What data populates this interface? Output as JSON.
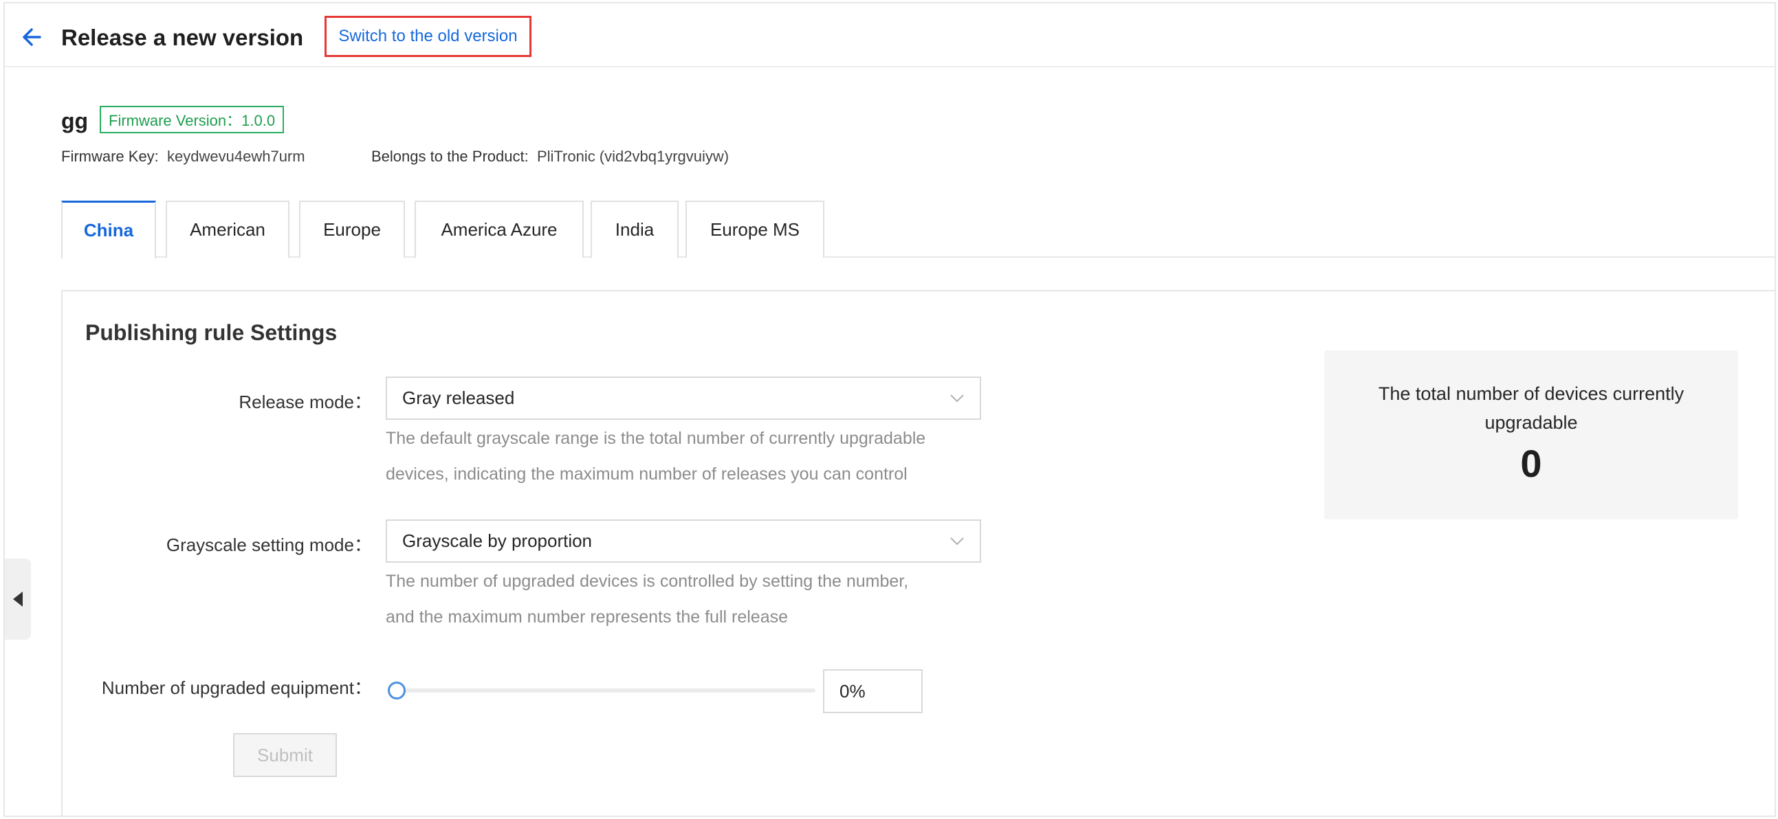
{
  "header": {
    "title": "Release a new version",
    "switch_label": "Switch to the old version"
  },
  "firmware": {
    "name": "gg",
    "version_badge": "Firmware Version：1.0.0",
    "key_label": "Firmware Key:",
    "key_value": "keydwevu4ewh7urm",
    "product_label": "Belongs to the Product:",
    "product_value": "PliTronic (vid2vbq1yrgvuiyw)"
  },
  "tabs": [
    {
      "label": "China",
      "active": true
    },
    {
      "label": "American"
    },
    {
      "label": "Europe"
    },
    {
      "label": "America Azure"
    },
    {
      "label": "India"
    },
    {
      "label": "Europe MS"
    }
  ],
  "rules": {
    "title": "Publishing rule Settings",
    "release_mode_label": "Release mode",
    "release_mode_value": "Gray released",
    "release_mode_help_1": "The default grayscale range is the total number of currently upgradable",
    "release_mode_help_2": "devices, indicating the maximum number of releases you can control",
    "gray_mode_label": "Grayscale setting mode",
    "gray_mode_value": "Grayscale by proportion",
    "gray_mode_help_1": "The number of upgraded devices is controlled by setting the number,",
    "gray_mode_help_2": "and the maximum number represents the full release",
    "upgraded_label": "Number of upgraded equipment",
    "upgraded_percent": 0,
    "upgraded_value": "0%",
    "submit_label": "Submit"
  },
  "stats": {
    "label": "The total number of devices currently upgradable",
    "value": "0"
  },
  "colors": {
    "accent": "#1668dc",
    "badge_green": "#27ae60",
    "highlight_red": "#e53935"
  }
}
